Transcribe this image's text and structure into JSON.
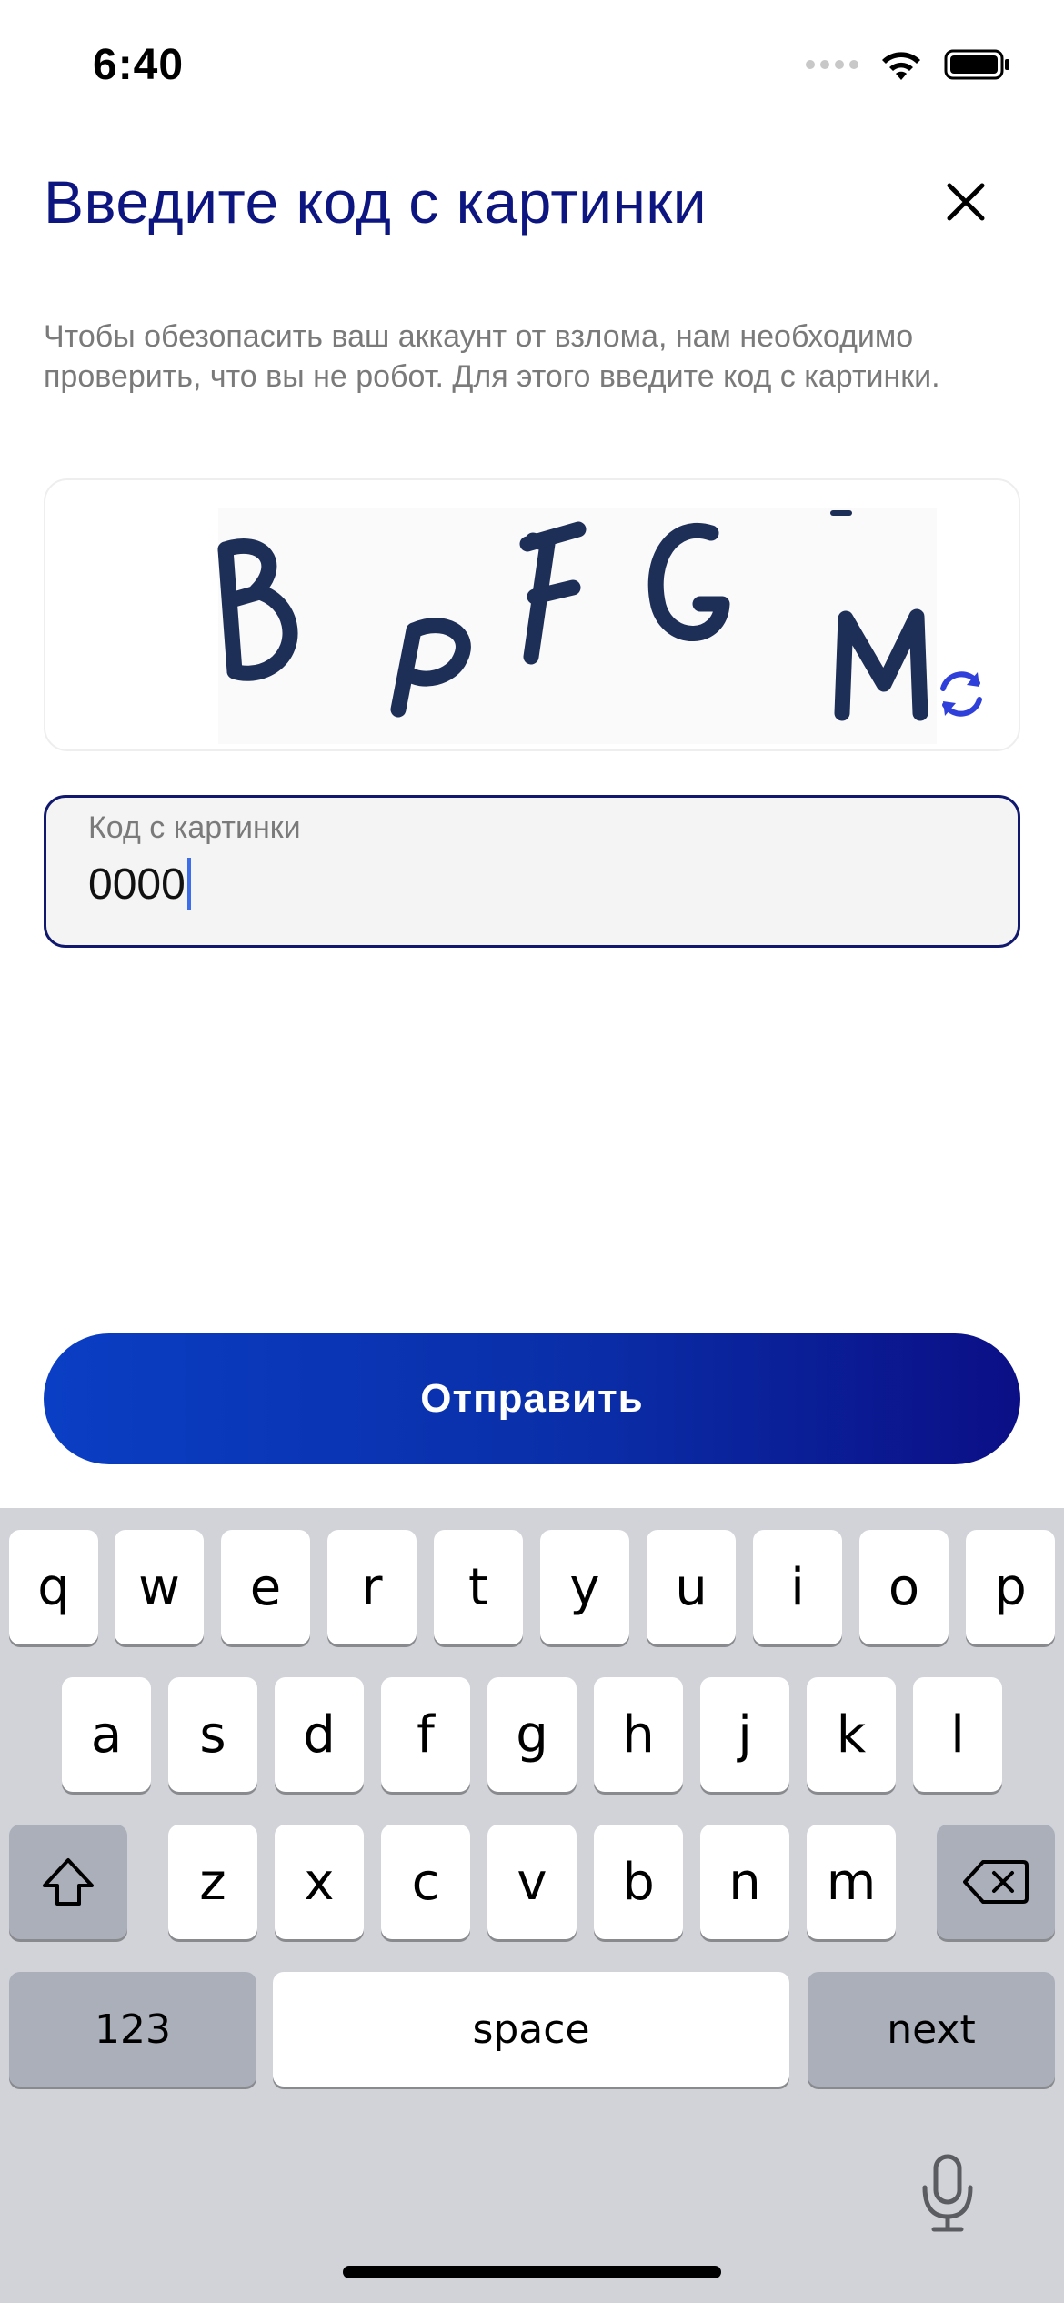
{
  "status_bar": {
    "time": "6:40"
  },
  "header": {
    "title": "Введите код с картинки"
  },
  "description": "Чтобы обезопасить ваш аккаунт от взлома, нам необходимо проверить, что вы не робот. Для этого введите код с картинки.",
  "captcha": {
    "text": "BPFGM"
  },
  "code_field": {
    "label": "Код с картинки",
    "value": "0000"
  },
  "submit": {
    "label": "Отправить"
  },
  "keyboard": {
    "row1": [
      "q",
      "w",
      "e",
      "r",
      "t",
      "y",
      "u",
      "i",
      "o",
      "p"
    ],
    "row2": [
      "a",
      "s",
      "d",
      "f",
      "g",
      "h",
      "j",
      "k",
      "l"
    ],
    "row3": [
      "z",
      "x",
      "c",
      "v",
      "b",
      "n",
      "m"
    ],
    "numbers_label": "123",
    "space_label": "space",
    "next_label": "next"
  },
  "colors": {
    "accent": "#0d1580",
    "button_start": "#0a3ec4",
    "button_end": "#0b0f86"
  }
}
